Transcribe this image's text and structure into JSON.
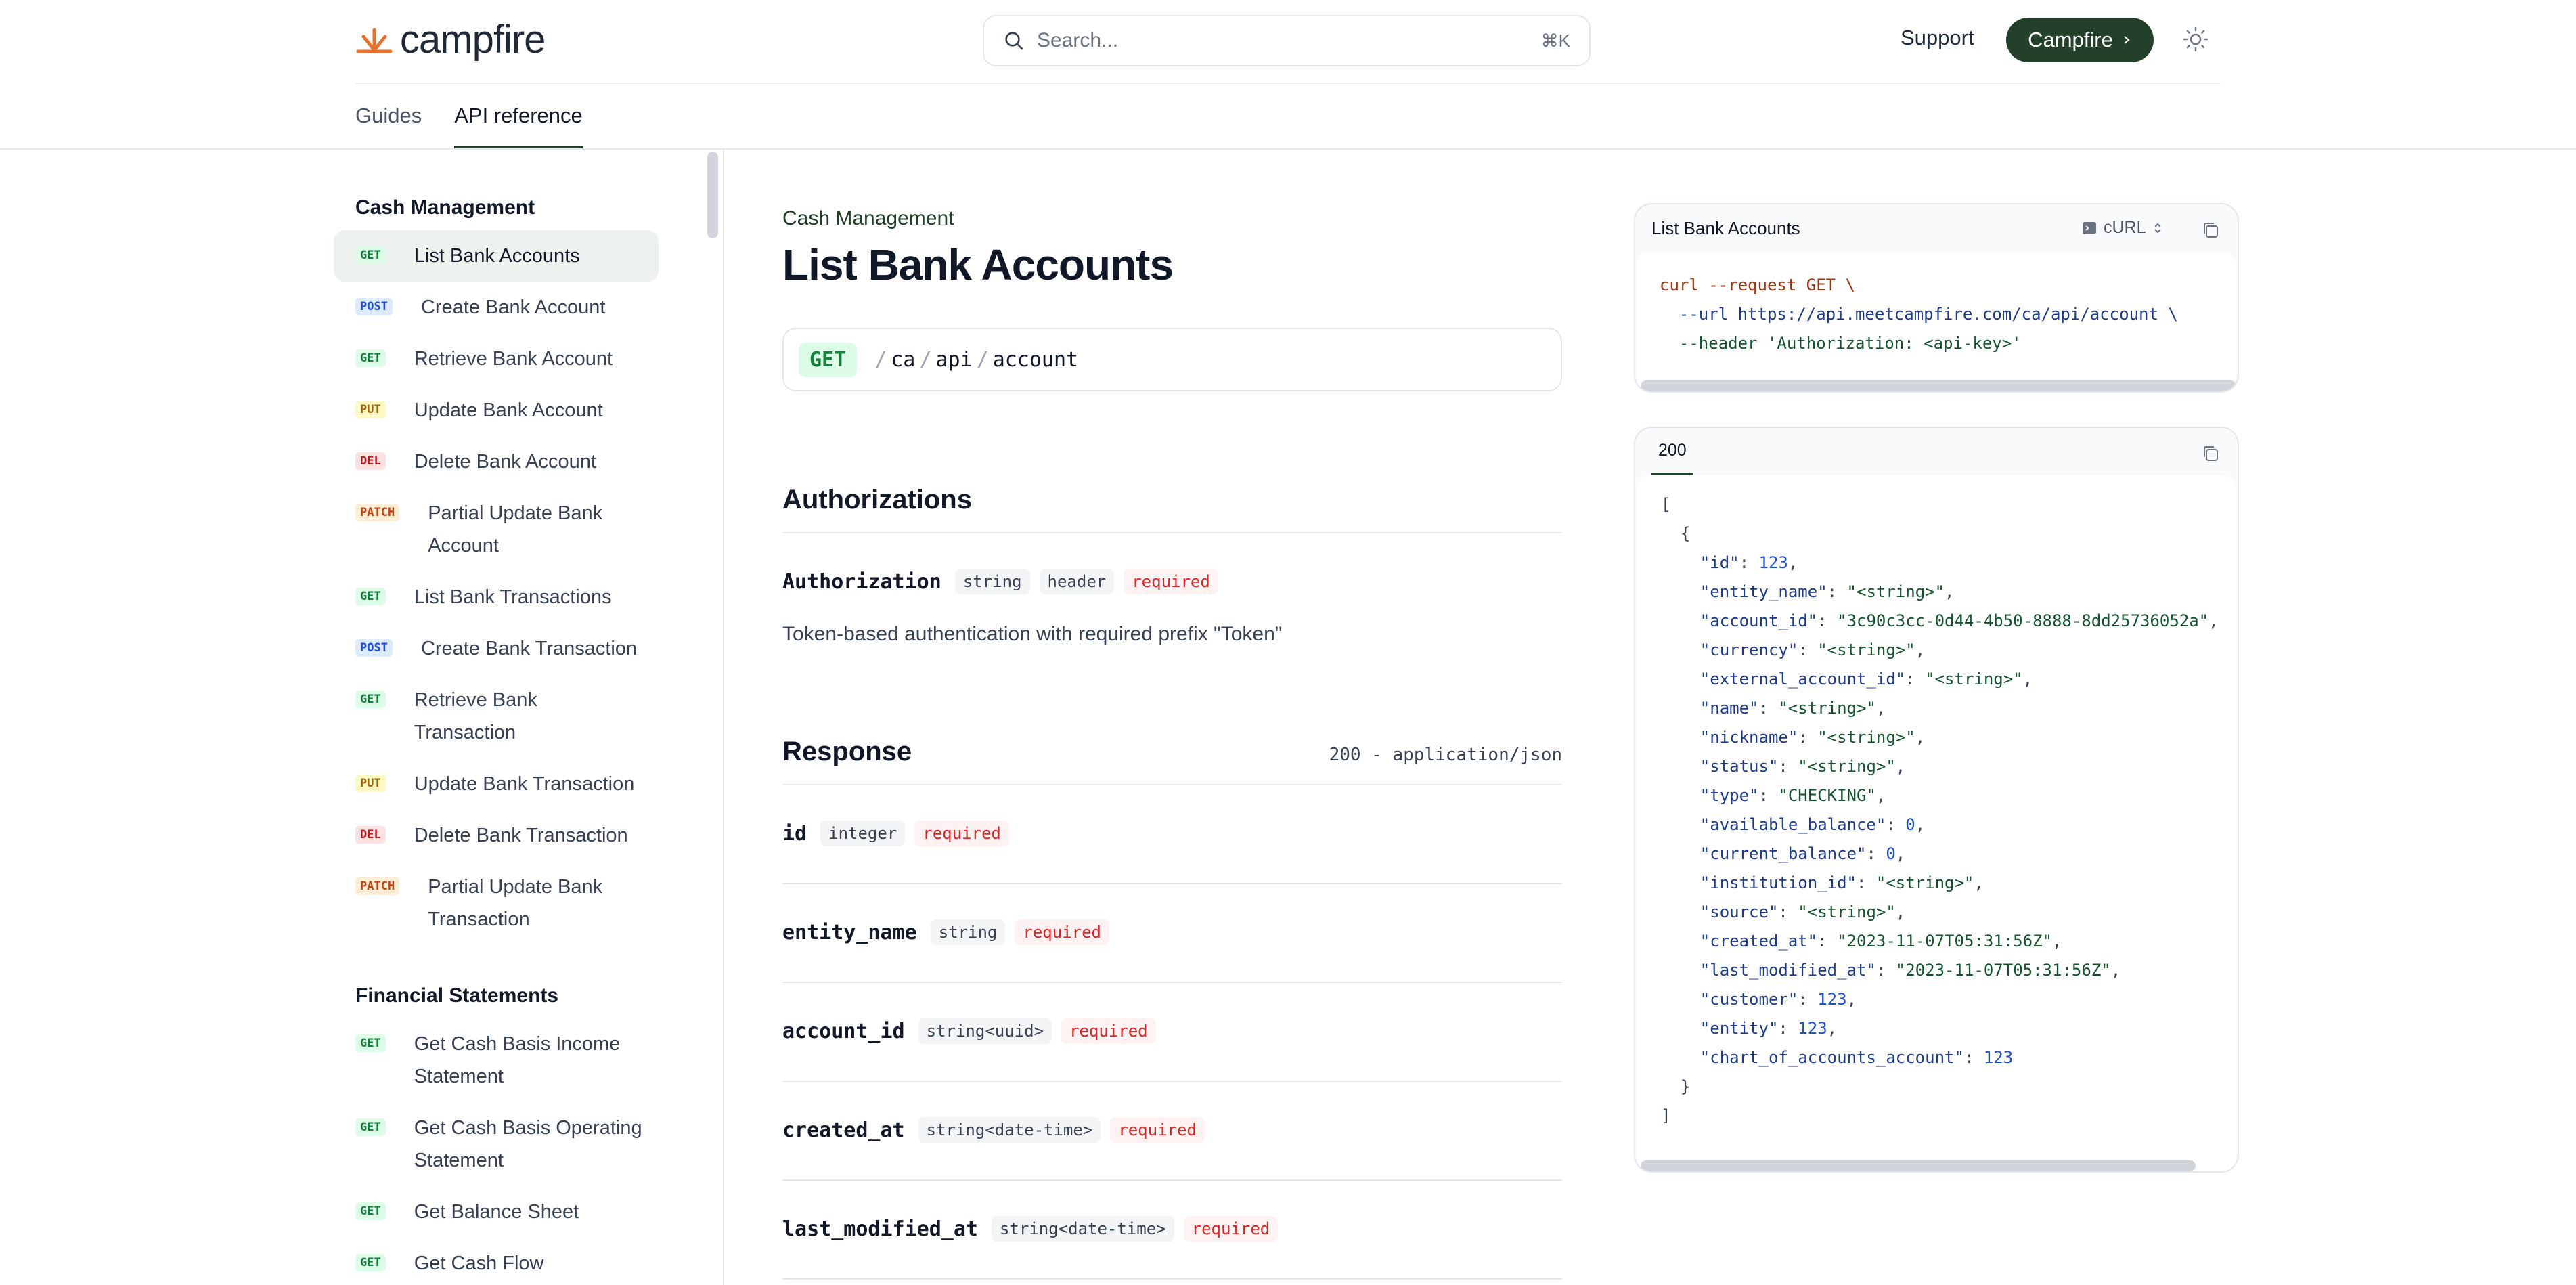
{
  "header": {
    "logo_text": "campfire",
    "search_placeholder": "Search...",
    "search_shortcut": "⌘K",
    "support_label": "Support",
    "cta_label": "Campfire",
    "accent_color": "#22402a"
  },
  "tabs": [
    {
      "label": "Guides",
      "active": false
    },
    {
      "label": "API reference",
      "active": true
    }
  ],
  "sidebar": {
    "sections": [
      {
        "title": "Cash Management",
        "items": [
          {
            "method": "GET",
            "label": "List Bank Accounts",
            "active": true
          },
          {
            "method": "POST",
            "label": "Create Bank Account"
          },
          {
            "method": "GET",
            "label": "Retrieve Bank Account"
          },
          {
            "method": "PUT",
            "label": "Update Bank Account"
          },
          {
            "method": "DEL",
            "label": "Delete Bank Account"
          },
          {
            "method": "PATCH",
            "label": "Partial Update Bank Account"
          },
          {
            "method": "GET",
            "label": "List Bank Transactions"
          },
          {
            "method": "POST",
            "label": "Create Bank Transaction"
          },
          {
            "method": "GET",
            "label": "Retrieve Bank Transaction"
          },
          {
            "method": "PUT",
            "label": "Update Bank Transaction"
          },
          {
            "method": "DEL",
            "label": "Delete Bank Transaction"
          },
          {
            "method": "PATCH",
            "label": "Partial Update Bank Transaction"
          }
        ]
      },
      {
        "title": "Financial Statements",
        "items": [
          {
            "method": "GET",
            "label": "Get Cash Basis Income Statement"
          },
          {
            "method": "GET",
            "label": "Get Cash Basis Operating Statement"
          },
          {
            "method": "GET",
            "label": "Get Balance Sheet"
          },
          {
            "method": "GET",
            "label": "Get Cash Flow"
          }
        ]
      }
    ]
  },
  "main": {
    "eyebrow": "Cash Management",
    "title": "List Bank Accounts",
    "endpoint": {
      "method": "GET",
      "segments": [
        "ca",
        "api",
        "account"
      ]
    },
    "authorizations": {
      "heading": "Authorizations",
      "field": {
        "name": "Authorization",
        "chips": [
          "string",
          "header"
        ],
        "required": "required"
      },
      "description": "Token-based authentication with required prefix \"Token\""
    },
    "response": {
      "heading": "Response",
      "type": "200 - application/json",
      "fields": [
        {
          "name": "id",
          "type": "integer",
          "required": "required"
        },
        {
          "name": "entity_name",
          "type": "string",
          "required": "required"
        },
        {
          "name": "account_id",
          "type": "string<uuid>",
          "required": "required"
        },
        {
          "name": "created_at",
          "type": "string<date-time>",
          "required": "required"
        },
        {
          "name": "last_modified_at",
          "type": "string<date-time>",
          "required": "required"
        }
      ]
    }
  },
  "request_panel": {
    "title": "List Bank Accounts",
    "language": "cURL",
    "lines": [
      "curl --request GET \\",
      "  --url https://api.meetcampfire.com/ca/api/account \\",
      "  --header 'Authorization: <api-key>'"
    ]
  },
  "response_panel": {
    "status_tab": "200",
    "open": "[",
    "obj_open": "  {",
    "entries": [
      {
        "key": "\"id\"",
        "value": "123",
        "kind": "n"
      },
      {
        "key": "\"entity_name\"",
        "value": "\"<string>\"",
        "kind": "str"
      },
      {
        "key": "\"account_id\"",
        "value": "\"3c90c3cc-0d44-4b50-8888-8dd25736052a\"",
        "kind": "str"
      },
      {
        "key": "\"currency\"",
        "value": "\"<string>\"",
        "kind": "str"
      },
      {
        "key": "\"external_account_id\"",
        "value": "\"<string>\"",
        "kind": "str"
      },
      {
        "key": "\"name\"",
        "value": "\"<string>\"",
        "kind": "str"
      },
      {
        "key": "\"nickname\"",
        "value": "\"<string>\"",
        "kind": "str"
      },
      {
        "key": "\"status\"",
        "value": "\"<string>\"",
        "kind": "str"
      },
      {
        "key": "\"type\"",
        "value": "\"CHECKING\"",
        "kind": "str"
      },
      {
        "key": "\"available_balance\"",
        "value": "0",
        "kind": "n"
      },
      {
        "key": "\"current_balance\"",
        "value": "0",
        "kind": "n"
      },
      {
        "key": "\"institution_id\"",
        "value": "\"<string>\"",
        "kind": "str"
      },
      {
        "key": "\"source\"",
        "value": "\"<string>\"",
        "kind": "str"
      },
      {
        "key": "\"created_at\"",
        "value": "\"2023-11-07T05:31:56Z\"",
        "kind": "str"
      },
      {
        "key": "\"last_modified_at\"",
        "value": "\"2023-11-07T05:31:56Z\"",
        "kind": "str"
      },
      {
        "key": "\"customer\"",
        "value": "123",
        "kind": "n"
      },
      {
        "key": "\"entity\"",
        "value": "123",
        "kind": "n"
      },
      {
        "key": "\"chart_of_accounts_account\"",
        "value": "123",
        "kind": "n"
      }
    ],
    "obj_close": "  }",
    "close": "]"
  }
}
